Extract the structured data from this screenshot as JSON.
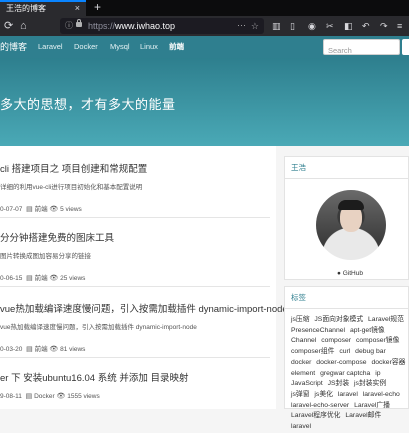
{
  "browser": {
    "tab_title": "王浩的博客",
    "tab_close": "×",
    "new_tab": "+",
    "url_prefix": "https://",
    "url_host": "www.iwhao.top",
    "url_more": "···",
    "bookmark_star": "☆"
  },
  "nav": {
    "logo": "的博客",
    "links": [
      "Laravel",
      "Docker",
      "Mysql",
      "Linux",
      "前端"
    ],
    "active_index": 4,
    "search_placeholder": "Search"
  },
  "hero": {
    "tagline": "多大的思想，才有多大的能量"
  },
  "posts": [
    {
      "title": "cli 搭建项目之 项目创建和常规配置",
      "excerpt": "详细的利用vue-cli进行项目初始化和基本配置说明",
      "date": "0-07-07",
      "category": "前端",
      "views": "5 views"
    },
    {
      "title": "分分钟搭建免费的图床工具",
      "excerpt": "图片转换成图加容易分享的链接",
      "date": "0-06-15",
      "category": "前端",
      "views": "25 views"
    },
    {
      "title": "vue热加载编译速度慢问题，引入按需加载插件 dynamic-import-node",
      "excerpt": "vue热加载编译速度慢问题，引入按需加载插件 dynamic-import-node",
      "date": "0-03-20",
      "category": "前端",
      "views": "81 views"
    },
    {
      "title": "er 下 安装ubuntu16.04 系统 并添加 目录映射",
      "excerpt": "",
      "date": "9-08-11",
      "category": "Docker",
      "views": "1555 views"
    }
  ],
  "author_panel": {
    "title": "王浩",
    "github_label": "GitHub"
  },
  "tags_panel": {
    "title": "标签",
    "tags": [
      "js压缩",
      "JS面向对象模式",
      "Laravel规范",
      "PresenceChannel",
      "apt-get镜像",
      "Channel",
      "composer",
      "composer镜像",
      "composer组件",
      "curl",
      "debug bar",
      "docker",
      "docker-compose",
      "docker容器",
      "element",
      "gregwar captcha",
      "ip",
      "JavaScript",
      "JS封装",
      "js封装实例",
      "js弹窗",
      "js美化",
      "laravel",
      "laravel-echo",
      "laravel-echo-server",
      "Laravel广播",
      "Laravel程序优化",
      "Laravel邮件",
      "laravel"
    ]
  }
}
